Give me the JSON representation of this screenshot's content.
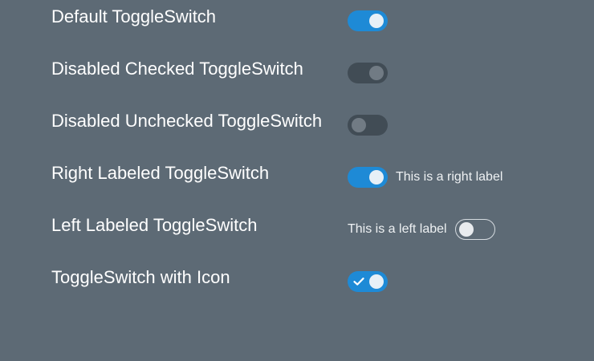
{
  "colors": {
    "background": "#5d6a75",
    "toggle_on": "#1e8ad6",
    "toggle_disabled": "#414c55",
    "knob_disabled": "#717b84"
  },
  "rows": [
    {
      "title": "Default ToggleSwitch",
      "checked": true,
      "disabled": false
    },
    {
      "title": "Disabled Checked ToggleSwitch",
      "checked": true,
      "disabled": true
    },
    {
      "title": "Disabled Unchecked ToggleSwitch",
      "checked": false,
      "disabled": true
    },
    {
      "title": "Right Labeled ToggleSwitch",
      "checked": true,
      "disabled": false,
      "right_label": "This is a right label"
    },
    {
      "title": "Left Labeled ToggleSwitch",
      "checked": false,
      "disabled": false,
      "left_label": "This is a left label"
    },
    {
      "title": "ToggleSwitch with Icon",
      "checked": true,
      "disabled": false,
      "icon": "check-icon"
    }
  ]
}
